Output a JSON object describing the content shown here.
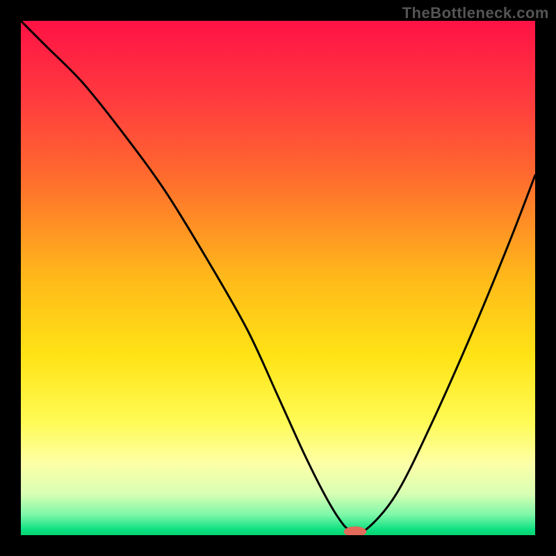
{
  "watermark": "TheBottleneck.com",
  "chart_data": {
    "type": "line",
    "title": "",
    "xlabel": "",
    "ylabel": "",
    "xlim": [
      0,
      100
    ],
    "ylim": [
      0,
      100
    ],
    "gradient_stops": [
      {
        "offset": 0,
        "color": "#ff1245"
      },
      {
        "offset": 15,
        "color": "#ff3a3f"
      },
      {
        "offset": 30,
        "color": "#ff6a2e"
      },
      {
        "offset": 50,
        "color": "#ffb91a"
      },
      {
        "offset": 65,
        "color": "#ffe315"
      },
      {
        "offset": 78,
        "color": "#fffb55"
      },
      {
        "offset": 86,
        "color": "#fdffa6"
      },
      {
        "offset": 92,
        "color": "#d8ffb4"
      },
      {
        "offset": 96,
        "color": "#7ef7a8"
      },
      {
        "offset": 99,
        "color": "#0be081"
      },
      {
        "offset": 100,
        "color": "#07d46f"
      }
    ],
    "series": [
      {
        "name": "bottleneck-curve",
        "x": [
          0,
          5,
          12,
          20,
          28,
          36,
          44,
          50,
          55,
          59,
          62,
          64,
          67,
          73,
          80,
          88,
          95,
          100
        ],
        "y": [
          100,
          95,
          88,
          78,
          67,
          54,
          40,
          27,
          16,
          8,
          3,
          1,
          1,
          8,
          22,
          40,
          57,
          70
        ]
      }
    ],
    "marker": {
      "name": "optimal-point",
      "x": 65.0,
      "y": 0.7,
      "rx": 2.2,
      "ry": 1.0,
      "color": "#e26a5a"
    }
  }
}
